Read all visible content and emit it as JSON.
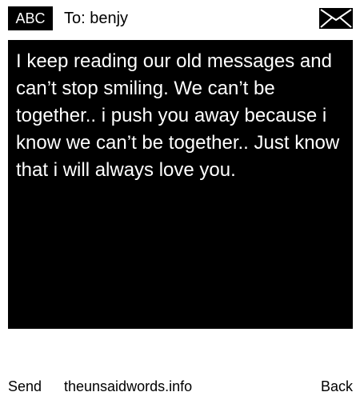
{
  "header": {
    "mode_label": "ABC",
    "recipient": "To: benjy",
    "envelope_icon": "envelope-icon"
  },
  "message": {
    "text": "I keep reading our old messages and can’t stop smiling. We can’t be together.. i push you away because i know we can’t be together.. Just know that i will always love you."
  },
  "footer": {
    "send_label": "Send",
    "site_text": "theunsaidwords.info",
    "back_label": "Back"
  },
  "colors": {
    "background": "#ffffff",
    "message_background": "#000000",
    "message_text": "#ffffff",
    "text": "#000000"
  }
}
